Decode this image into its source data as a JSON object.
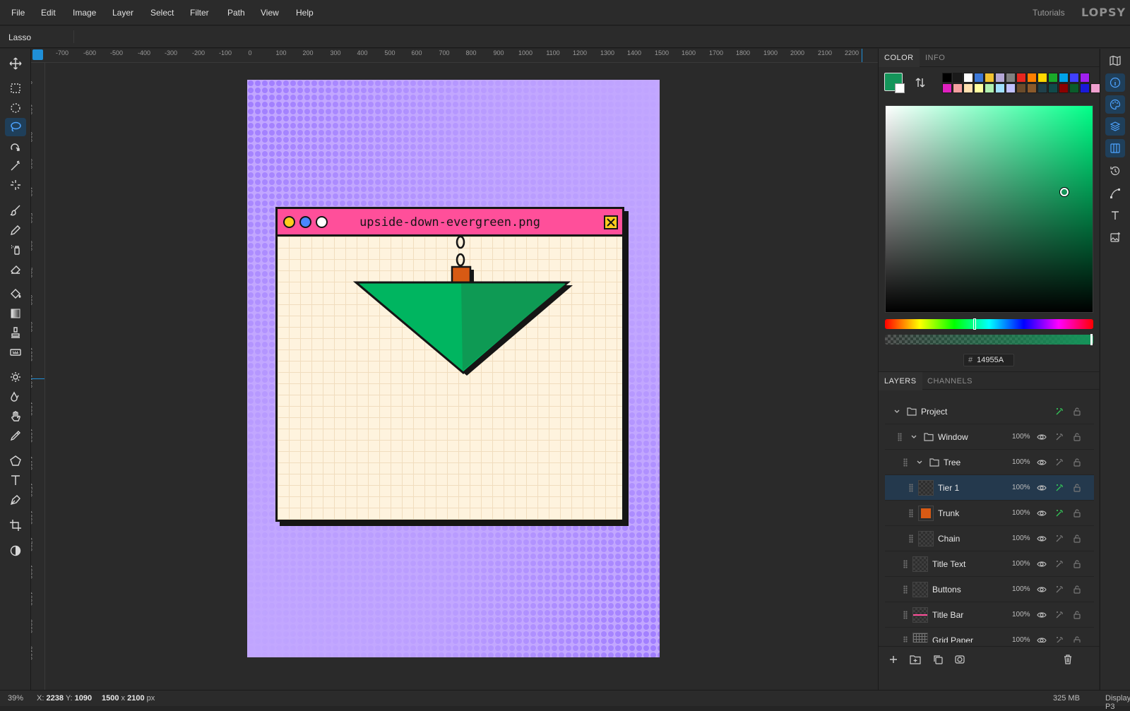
{
  "menu": {
    "items": [
      "File",
      "Edit",
      "Image",
      "Layer",
      "Select",
      "Filter",
      "Path",
      "View",
      "Help"
    ],
    "tutorials": "Tutorials",
    "logo": "LOPSY"
  },
  "options": {
    "tool_name": "Lasso"
  },
  "tools": [
    "move-icon",
    "rect-select-icon",
    "ellipse-select-icon",
    "lasso-icon",
    "magnetic-lasso-icon",
    "magic-wand-icon",
    "quick-select-icon",
    "brush-icon",
    "pencil-icon",
    "spray-icon",
    "eraser-icon",
    "bucket-icon",
    "gradient-icon",
    "stamp-icon",
    "patch-icon",
    "dodge-icon",
    "blur-icon",
    "hand-icon",
    "eyedropper-icon",
    "polygon-icon",
    "text-icon",
    "pen-icon",
    "crop-icon",
    "contrast-icon"
  ],
  "active_tool": "lasso-icon",
  "ruler": {
    "h": [
      "-700",
      "-600",
      "-500",
      "-400",
      "-300",
      "-200",
      "-100",
      "0",
      "100",
      "200",
      "300",
      "400",
      "500",
      "600",
      "700",
      "800",
      "900",
      "1000",
      "1100",
      "1200",
      "1300",
      "1400",
      "1500",
      "1600",
      "1700",
      "1800",
      "1900",
      "2000",
      "2100",
      "2200"
    ],
    "v": [
      "0",
      "100",
      "200",
      "300",
      "400",
      "500",
      "600",
      "700",
      "800",
      "900",
      "1000",
      "1100",
      "1200",
      "1300",
      "1400",
      "1500",
      "1600",
      "1700",
      "1800",
      "1900",
      "2000",
      "2100"
    ]
  },
  "document": {
    "window_title": "upside-down-evergreen.png"
  },
  "color_panel": {
    "tabs": [
      "COLOR",
      "INFO"
    ],
    "foreground": "#14955A",
    "hex_label": "#",
    "hex": "14955A",
    "hue_fraction": 0.43,
    "sv_saturation": 0.86,
    "sv_value": 0.58,
    "palette": [
      "#000000",
      "#1a1a1a",
      "#ffffff",
      "#3c78d8",
      "#f1c232",
      "#b4a7d6",
      "#808080",
      "#e8261f",
      "#ff7f00",
      "#ffd700",
      "#1aaa2a",
      "#00a2e8",
      "#4040ff",
      "#a020f0",
      "#e020c0",
      "#f4a0a0",
      "#ffe0b0",
      "#ffffa0",
      "#b0f0b0",
      "#a0e0ff",
      "#c0c0ff",
      "#6b4b2b",
      "#8b5a2b",
      "#20404a",
      "#104a4a",
      "#8b0000",
      "#0a5c2a",
      "#1a1ad8",
      "#f0a0d0"
    ]
  },
  "layers_panel": {
    "tabs": [
      "LAYERS",
      "CHANNELS"
    ],
    "layers": [
      {
        "name": "Project",
        "opacity": "",
        "kind": "folder",
        "depth": 0
      },
      {
        "name": "Window",
        "opacity": "100%",
        "kind": "folder",
        "depth": 1
      },
      {
        "name": "Tree",
        "opacity": "100%",
        "kind": "folder",
        "depth": 2
      },
      {
        "name": "Tier 1",
        "opacity": "100%",
        "kind": "layer",
        "depth": 3
      },
      {
        "name": "Trunk",
        "opacity": "100%",
        "kind": "layer",
        "depth": 3
      },
      {
        "name": "Chain",
        "opacity": "100%",
        "kind": "layer",
        "depth": 3
      },
      {
        "name": "Title Text",
        "opacity": "100%",
        "kind": "layer",
        "depth": 2
      },
      {
        "name": "Buttons",
        "opacity": "100%",
        "kind": "layer",
        "depth": 2
      },
      {
        "name": "Title Bar",
        "opacity": "100%",
        "kind": "layer",
        "depth": 2
      },
      {
        "name": "Grid Paper",
        "opacity": "100%",
        "kind": "layer",
        "depth": 2
      }
    ],
    "selected": "Tier 1"
  },
  "status": {
    "zoom": "39%",
    "x_label": "X:",
    "x": "2238",
    "y_label": "Y:",
    "y": "1090",
    "width": "1500",
    "height": "2100",
    "x_sep": "x",
    "unit": "px",
    "memory": "325 MB",
    "colorspace": "Display P3"
  }
}
